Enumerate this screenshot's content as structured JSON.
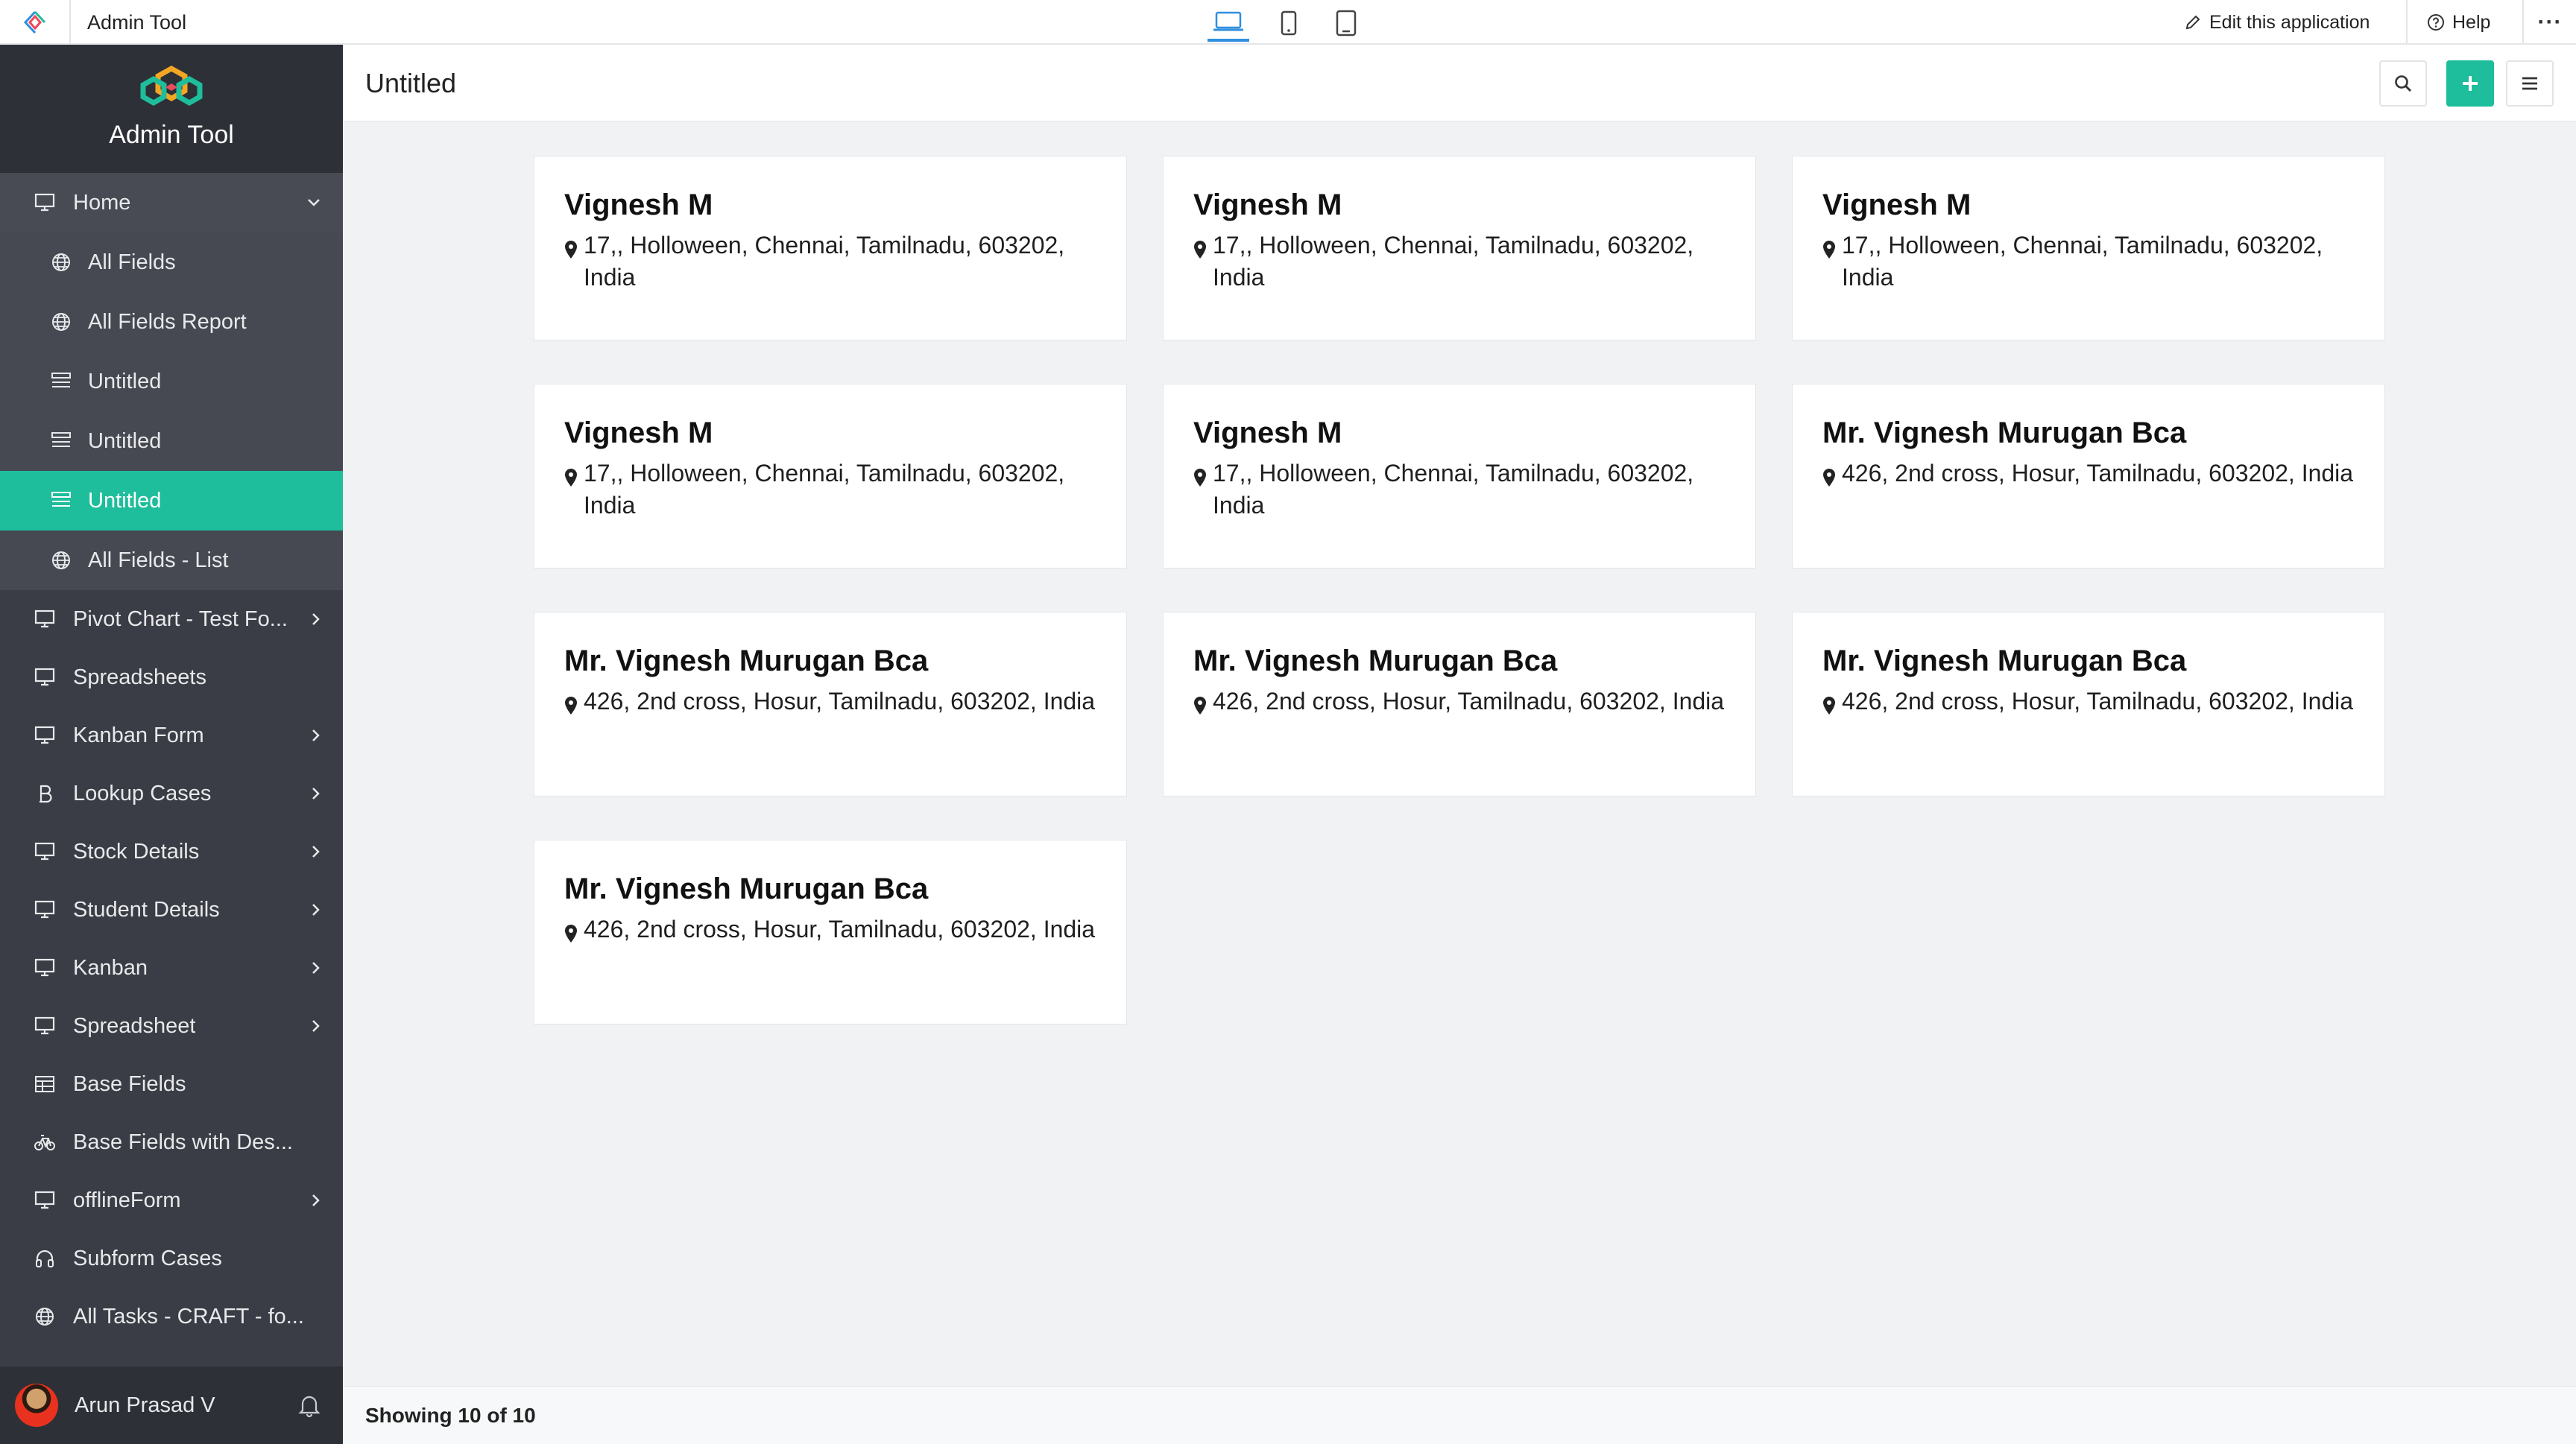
{
  "topbar": {
    "app_title": "Admin Tool",
    "edit_label": "Edit this application",
    "help_label": "Help",
    "more_label": "···"
  },
  "sidebar": {
    "brand_name": "Admin Tool",
    "home_label": "Home",
    "sub_items": [
      {
        "label": "All Fields",
        "icon": "globe-icon"
      },
      {
        "label": "All Fields Report",
        "icon": "globe-icon"
      },
      {
        "label": "Untitled",
        "icon": "list-icon"
      },
      {
        "label": "Untitled",
        "icon": "list-icon"
      },
      {
        "label": "Untitled",
        "icon": "list-icon",
        "active": true
      },
      {
        "label": "All Fields - List",
        "icon": "globe-icon"
      }
    ],
    "items": [
      {
        "label": "Pivot Chart - Test Fo...",
        "icon": "monitor-icon"
      },
      {
        "label": "Spreadsheets",
        "icon": "monitor-icon"
      },
      {
        "label": "Kanban Form",
        "icon": "monitor-icon"
      },
      {
        "label": "Lookup Cases",
        "icon": "bitcoin-icon"
      },
      {
        "label": "Stock Details",
        "icon": "monitor-icon"
      },
      {
        "label": "Student Details",
        "icon": "monitor-icon"
      },
      {
        "label": "Kanban",
        "icon": "monitor-icon"
      },
      {
        "label": "Spreadsheet",
        "icon": "monitor-icon"
      },
      {
        "label": "Base Fields",
        "icon": "table-icon"
      },
      {
        "label": "Base Fields with Des...",
        "icon": "bicycle-icon"
      },
      {
        "label": "offlineForm",
        "icon": "monitor-icon"
      },
      {
        "label": "Subform Cases",
        "icon": "headphones-icon"
      },
      {
        "label": "All Tasks - CRAFT - fo...",
        "icon": "globe-icon"
      }
    ],
    "user_name": "Arun Prasad V"
  },
  "main": {
    "title": "Untitled",
    "footer_text": "Showing 10 of 10",
    "cards": [
      {
        "name": "Vignesh M",
        "address": "17,, Holloween, Chennai, Tamilnadu, 603202, India"
      },
      {
        "name": "Vignesh M",
        "address": "17,, Holloween, Chennai, Tamilnadu, 603202, India"
      },
      {
        "name": "Vignesh M",
        "address": "17,, Holloween, Chennai, Tamilnadu, 603202, India"
      },
      {
        "name": "Vignesh M",
        "address": "17,, Holloween, Chennai, Tamilnadu, 603202, India"
      },
      {
        "name": "Vignesh M",
        "address": "17,, Holloween, Chennai, Tamilnadu, 603202, India"
      },
      {
        "name": "Mr. Vignesh Murugan Bca",
        "address": "426, 2nd cross, Hosur, Tamilnadu, 603202, India"
      },
      {
        "name": "Mr. Vignesh Murugan Bca",
        "address": "426, 2nd cross, Hosur, Tamilnadu, 603202, India"
      },
      {
        "name": "Mr. Vignesh Murugan Bca",
        "address": "426, 2nd cross, Hosur, Tamilnadu, 603202, India"
      },
      {
        "name": "Mr. Vignesh Murugan Bca",
        "address": "426, 2nd cross, Hosur, Tamilnadu, 603202, India"
      },
      {
        "name": "Mr. Vignesh Murugan Bca",
        "address": "426, 2nd cross, Hosur, Tamilnadu, 603202, India"
      }
    ]
  },
  "colors": {
    "accent": "#1ebd9b",
    "sidebar_bg": "#3a3d45",
    "device_active": "#2f8ee0"
  }
}
